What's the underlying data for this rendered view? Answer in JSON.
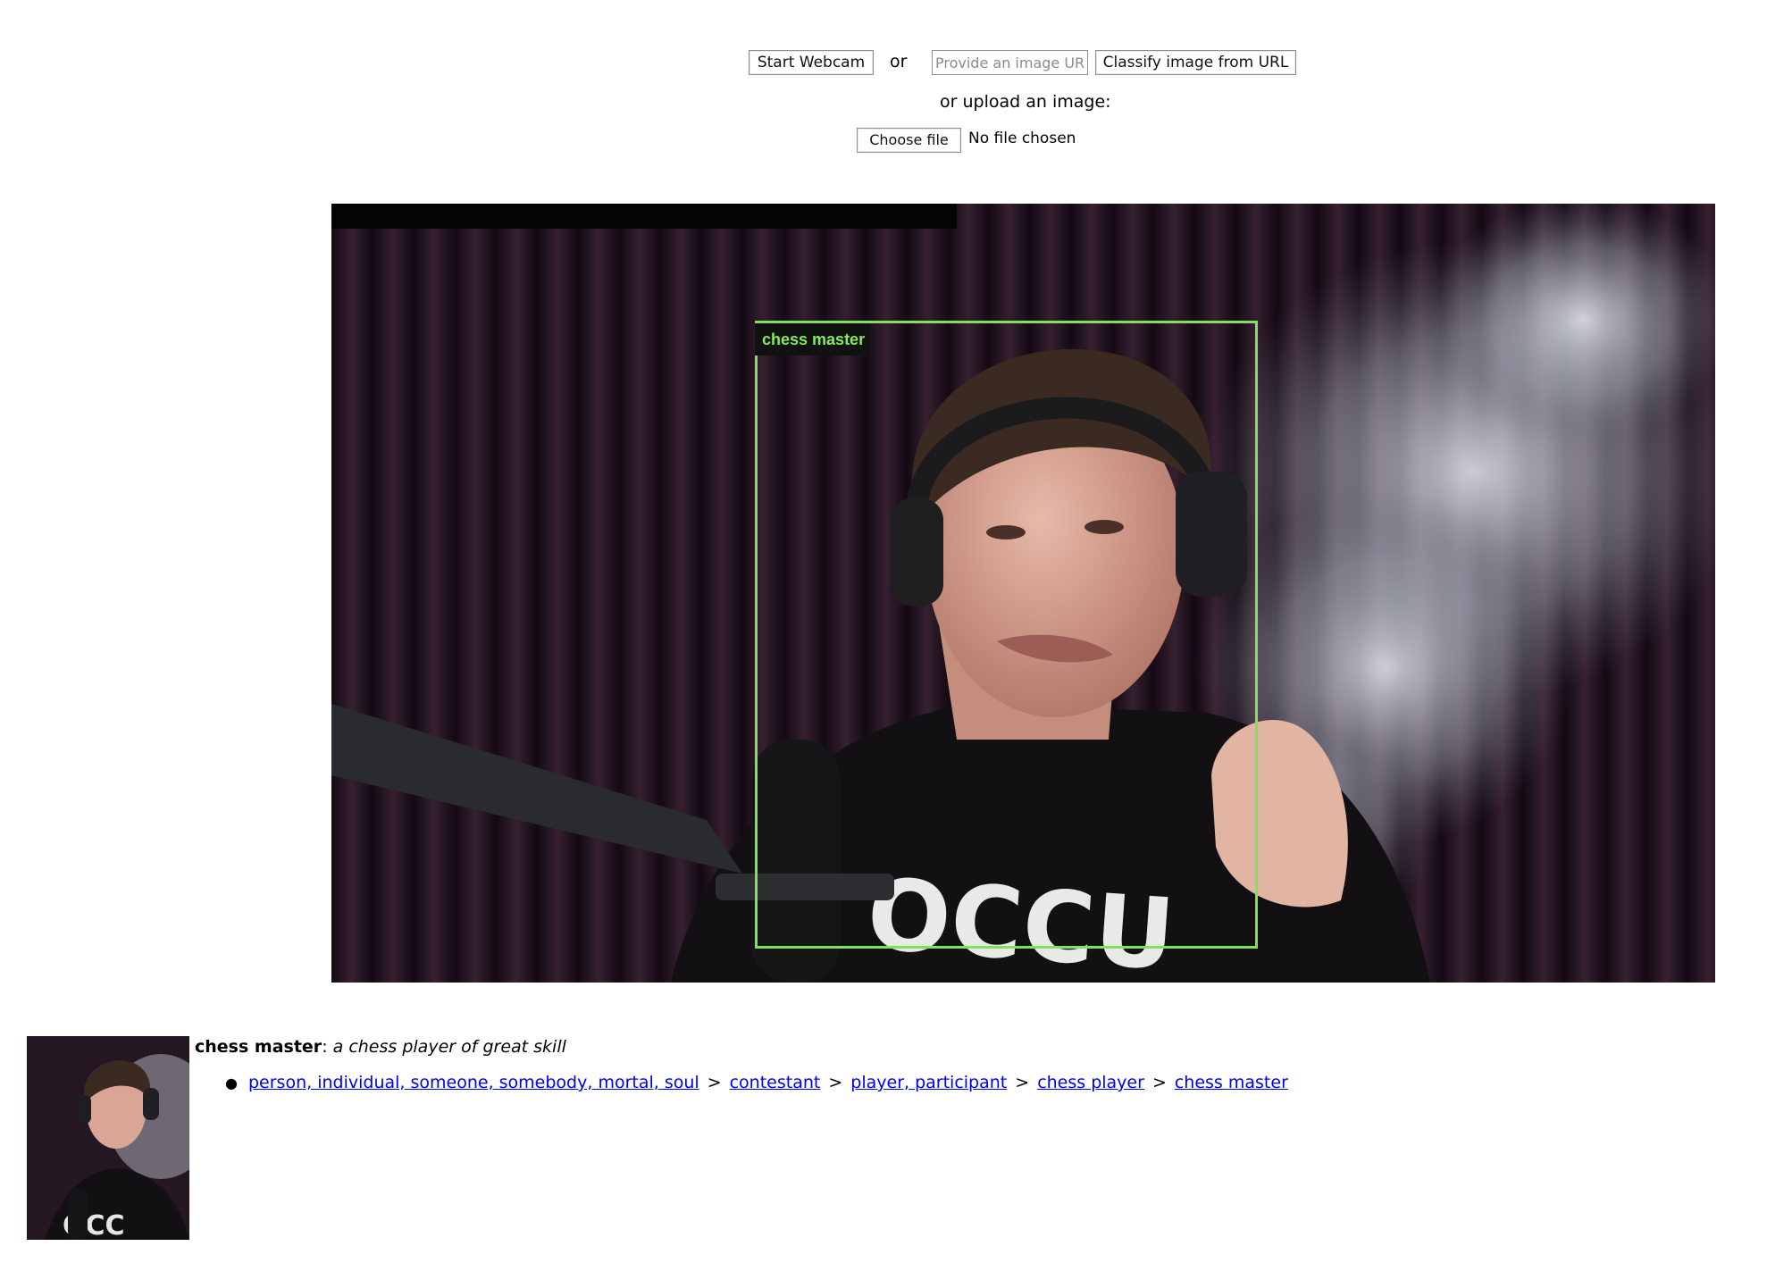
{
  "controls": {
    "start_webcam_label": "Start Webcam",
    "or_text": "or",
    "url_placeholder": "Provide an image URL",
    "classify_url_label": "Classify image from URL",
    "upload_label": "or upload an image:",
    "choose_file_label": "Choose file",
    "file_status": "No file chosen"
  },
  "detection": {
    "label": "chess master",
    "box_color": "#7fe35a"
  },
  "result": {
    "name": "chess master",
    "colon": ":",
    "definition": "a chess player of great skill",
    "hierarchy": [
      "person, individual, someone, somebody, mortal, soul",
      "contestant",
      "player, participant",
      "chess player",
      "chess master"
    ],
    "separator": ">"
  },
  "icons": {
    "bullet": "bullet-dot"
  }
}
